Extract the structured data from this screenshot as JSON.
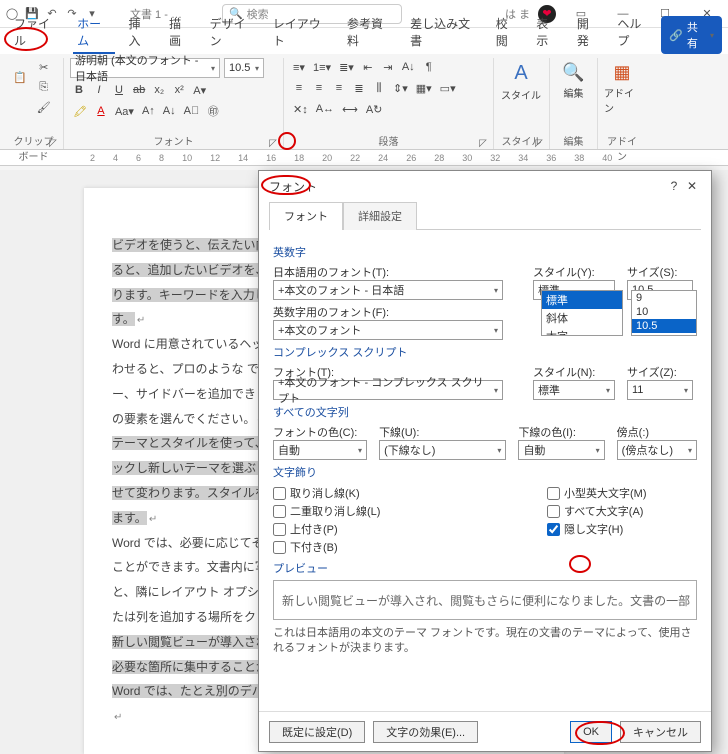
{
  "titlebar": {
    "doc_title": "文書 1 - …",
    "search_placeholder": "検索",
    "user_short": "は ま"
  },
  "tabs": {
    "file": "ファイル",
    "home": "ホーム",
    "insert": "挿入",
    "draw": "描画",
    "design": "デザイン",
    "layout": "レイアウト",
    "ref": "参考資料",
    "mail": "差し込み文書",
    "review": "校閲",
    "view": "表示",
    "dev": "開発",
    "help": "ヘルプ",
    "share": "共有"
  },
  "ribbon": {
    "clipboard_label": "クリップボード",
    "font_label": "フォント",
    "paragraph_label": "段落",
    "styles_label": "スタイル",
    "editing_label": "編集",
    "addin_label": "アドイン",
    "font_name": "游明朝 (本文のフォント - 日本語",
    "font_size": "10.5",
    "styles_btn": "スタイル",
    "editing_btn": "編集",
    "addin_btn": "アドイン"
  },
  "ruler": [
    "2",
    "4",
    "6",
    "8",
    "10",
    "12",
    "14",
    "16",
    "18",
    "20",
    "22",
    "24",
    "26",
    "28",
    "30",
    "32",
    "34",
    "36",
    "38",
    "40"
  ],
  "document": {
    "p1": "ビデオを使うと、伝えたい内",
    "p2": "ると、追加したいビデオを、",
    "p3": "ります。キーワードを入力し",
    "p3b": "す。",
    "p4": "Word に用意されているヘッ",
    "p5": "わせると、プロのような でき",
    "p6": "ー、サイドバーを追加できま",
    "p7": "の要素を選んでください。",
    "p8": "テーマとスタイルを使って、",
    "p9": "ックし新しいテーマを選ぶと",
    "p10": "せて変わります。スタイルを",
    "p10b": "ます。",
    "p11": "Word では、必要に応じてそ",
    "p12": "ことができます。文書内に写",
    "p13": "と、隣にレイアウト オプシ",
    "p14": "たは列を追加する場所をクリ",
    "p15": "新しい閲覧ビューが導入され",
    "p16": "必要な箇所に集中することが",
    "p17": "Word では、たとえ別のデバ"
  },
  "dialog": {
    "title": "フォント",
    "help": "?",
    "tab_font": "フォント",
    "tab_adv": "詳細設定",
    "sec_alnum": "英数字",
    "lbl_jp_font": "日本語用のフォント(T):",
    "val_jp_font": "+本文のフォント - 日本語",
    "lbl_style": "スタイル(Y):",
    "val_style": "標準",
    "style_list": [
      "標準",
      "斜体",
      "太字"
    ],
    "lbl_size": "サイズ(S):",
    "val_size": "10.5",
    "size_list": [
      "9",
      "10",
      "10.5"
    ],
    "lbl_en_font": "英数字用のフォント(F):",
    "val_en_font": "+本文のフォント",
    "sec_complex": "コンプレックス スクリプト",
    "lbl_cfont": "フォント(T):",
    "val_cfont": "+本文のフォント - コンプレックス スクリプト",
    "lbl_cstyle": "スタイル(N):",
    "val_cstyle": "標準",
    "lbl_csize": "サイズ(Z):",
    "val_csize": "11",
    "sec_all": "すべての文字列",
    "lbl_color": "フォントの色(C):",
    "val_color": "自動",
    "lbl_under": "下線(U):",
    "val_under": "(下線なし)",
    "lbl_ucolor": "下線の色(I):",
    "val_ucolor": "自動",
    "lbl_em": "傍点(:)",
    "val_em": "(傍点なし)",
    "sec_deco": "文字飾り",
    "chk_strike": "取り消し線(K)",
    "chk_dstrike": "二重取り消し線(L)",
    "chk_super": "上付き(P)",
    "chk_sub": "下付き(B)",
    "chk_small": "小型英大文字(M)",
    "chk_caps": "すべて大文字(A)",
    "chk_hidden": "隠し文字(H)",
    "sec_preview": "プレビュー",
    "preview_text": "新しい閲覧ビューが導入され、閲覧もさらに便利になりました。文書の一部",
    "note": "これは日本語用の本文のテーマ フォントです。現在の文書のテーマによって、使用されるフォントが決まります。",
    "btn_default": "既定に設定(D)",
    "btn_effects": "文字の効果(E)...",
    "btn_ok": "OK",
    "btn_cancel": "キャンセル"
  }
}
